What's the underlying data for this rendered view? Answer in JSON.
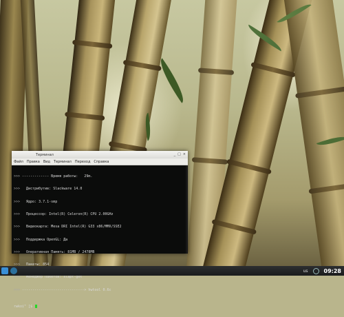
{
  "terminal": {
    "title": "Терминал",
    "controls": [
      "_",
      "□",
      "×"
    ],
    "menu": [
      "Файл",
      "Правка",
      "Вид",
      "Терминал",
      "Переход",
      "Справка"
    ],
    "lines": [
      {
        "prompt": ">>>",
        "text": " ------------- Время работы:   29m."
      },
      {
        "prompt": ">>>",
        "text": "   Дистрибутив: Slackware 14.0"
      },
      {
        "prompt": ">>>",
        "text": "   Ядро: 3.7.1-smp"
      },
      {
        "prompt": ">>>",
        "text": "   Процессор: Intel(R) Celeron(R) CPU 2.00GHz"
      },
      {
        "prompt": ">>>",
        "text": "   Видеокарта: Mesa DRI Intel(R) G33 x86/MMX/SSE2"
      },
      {
        "prompt": ">>>",
        "text": "   Поддержка OpenGL: Да"
      },
      {
        "prompt": ">>>",
        "text": "   Оперативная Память: 81MB / 2478MB"
      },
      {
        "prompt": ">>>",
        "text": "   Пакеты: 854"
      },
      {
        "prompt": ">>>",
        "text": "   Менеджер Пакетов: slapt-get"
      },
      {
        "prompt": ">>>",
        "text": " ------------------------------> hwtool 0.6c"
      }
    ],
    "prompt": "rwkoi\" ]$"
  },
  "taskbar": {
    "layout_indicator": "us",
    "clock": "09:28"
  },
  "colors": {
    "cursor": "#27d82a",
    "terminal_bg": "#0b0c0b",
    "taskbar_bg": "#1f2021",
    "menu_icon": "#3a8fd6"
  },
  "icons": [
    "start-menu-icon",
    "show-desktop-icon",
    "network-tray-icon"
  ]
}
